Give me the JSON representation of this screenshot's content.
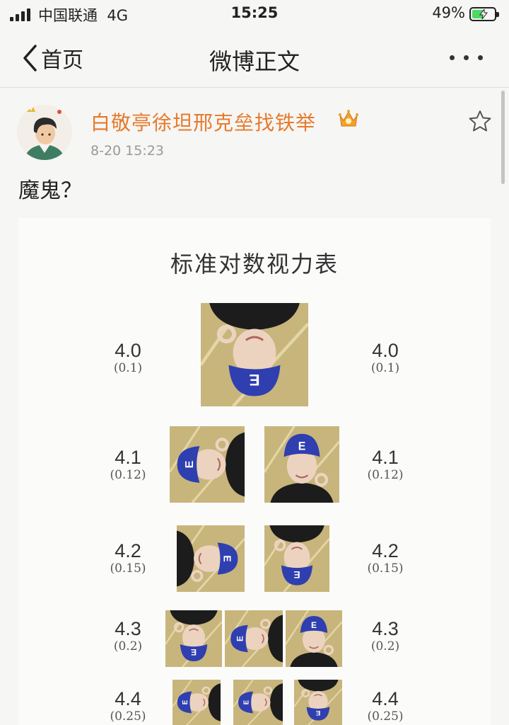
{
  "status_bar": {
    "carrier": "中国联通",
    "network": "4G",
    "time": "15:25",
    "battery_percent": "49%",
    "icons": [
      "signal-bars-icon",
      "battery-charging-icon"
    ]
  },
  "nav": {
    "back_label": "首页",
    "title": "微博正文",
    "icons": [
      "chevron-left-icon",
      "more-dots-icon"
    ]
  },
  "post": {
    "username": "白敬亭徐坦邢克垒找铁举",
    "timestamp": "8-20 15:23",
    "text": "魔鬼？",
    "icons": [
      "avatar-cartoon",
      "crown-badge-icon",
      "star-outline-icon"
    ]
  },
  "eye_chart": {
    "title": "标准对数视力表",
    "rows": [
      {
        "left_value": "4.0",
        "left_decimal": "(0.1)",
        "right_value": "4.0",
        "right_decimal": "(0.1)",
        "photos": 1
      },
      {
        "left_value": "4.1",
        "left_decimal": "(0.12)",
        "right_value": "4.1",
        "right_decimal": "(0.12)",
        "photos": 2
      },
      {
        "left_value": "4.2",
        "left_decimal": "(0.15)",
        "right_value": "4.2",
        "right_decimal": "(0.15)",
        "photos": 2
      },
      {
        "left_value": "4.3",
        "left_decimal": "(0.2)",
        "right_value": "4.3",
        "right_decimal": "(0.2)",
        "photos": 3
      },
      {
        "left_value": "4.4",
        "left_decimal": "(0.25)",
        "right_value": "4.4",
        "right_decimal": "(0.25)",
        "photos": 3
      }
    ],
    "photo_orientations": [
      "down",
      "left",
      "up",
      "right",
      "down",
      "down",
      "left",
      "up",
      "left",
      "left",
      "down"
    ],
    "colors": {
      "cap": "#2f3fb0",
      "backdrop": "#c8b57c",
      "shirt": "#1c1c1c",
      "skin": "#ecd3c0"
    }
  }
}
